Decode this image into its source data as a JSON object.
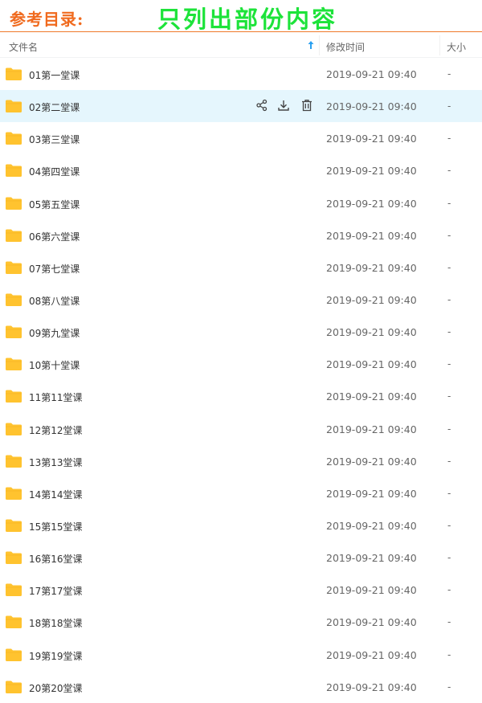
{
  "banner": {
    "left_text": "参考目录:",
    "right_text": "只列出部份内容"
  },
  "header": {
    "col_name": "文件名",
    "col_time": "修改时间",
    "col_size": "大小"
  },
  "colors": {
    "banner_orange": "#f06a1e",
    "banner_green": "#1de33a",
    "folder_yellow": "#ffc32f",
    "selected_bg": "#e5f6fd",
    "sort_blue": "#2aa0f0"
  },
  "rows": [
    {
      "name": "01第一堂课",
      "time": "2019-09-21 09:40",
      "size": "-"
    },
    {
      "name": "02第二堂课",
      "time": "2019-09-21 09:40",
      "size": "-"
    },
    {
      "name": "03第三堂课",
      "time": "2019-09-21 09:40",
      "size": "-"
    },
    {
      "name": "04第四堂课",
      "time": "2019-09-21 09:40",
      "size": "-"
    },
    {
      "name": "05第五堂课",
      "time": "2019-09-21 09:40",
      "size": "-"
    },
    {
      "name": "06第六堂课",
      "time": "2019-09-21 09:40",
      "size": "-"
    },
    {
      "name": "07第七堂课",
      "time": "2019-09-21 09:40",
      "size": "-"
    },
    {
      "name": "08第八堂课",
      "time": "2019-09-21 09:40",
      "size": "-"
    },
    {
      "name": "09第九堂课",
      "time": "2019-09-21 09:40",
      "size": "-"
    },
    {
      "name": "10第十堂课",
      "time": "2019-09-21 09:40",
      "size": "-"
    },
    {
      "name": "11第11堂课",
      "time": "2019-09-21 09:40",
      "size": "-"
    },
    {
      "name": "12第12堂课",
      "time": "2019-09-21 09:40",
      "size": "-"
    },
    {
      "name": "13第13堂课",
      "time": "2019-09-21 09:40",
      "size": "-"
    },
    {
      "name": "14第14堂课",
      "time": "2019-09-21 09:40",
      "size": "-"
    },
    {
      "name": "15第15堂课",
      "time": "2019-09-21 09:40",
      "size": "-"
    },
    {
      "name": "16第16堂课",
      "time": "2019-09-21 09:40",
      "size": "-"
    },
    {
      "name": "17第17堂课",
      "time": "2019-09-21 09:40",
      "size": "-"
    },
    {
      "name": "18第18堂课",
      "time": "2019-09-21 09:40",
      "size": "-"
    },
    {
      "name": "19第19堂课",
      "time": "2019-09-21 09:40",
      "size": "-"
    },
    {
      "name": "20第20堂课",
      "time": "2019-09-21 09:40",
      "size": "-"
    }
  ],
  "selected_row": 1,
  "row_actions": [
    "share-icon",
    "download-icon",
    "delete-icon"
  ]
}
